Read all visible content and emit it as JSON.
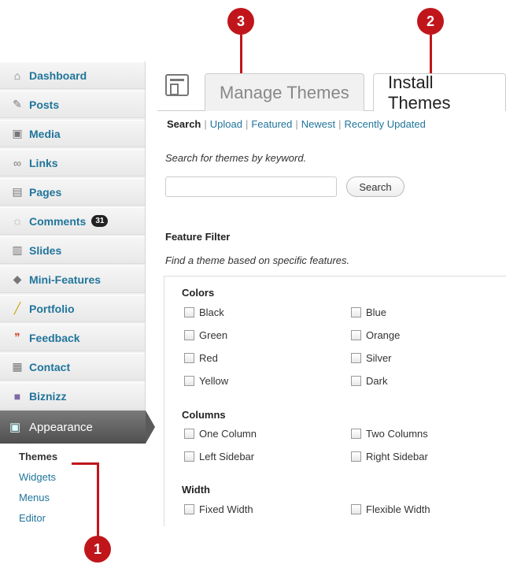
{
  "callouts": [
    "1",
    "2",
    "3"
  ],
  "sidebar": {
    "items": [
      {
        "label": "Dashboard",
        "icon": "home-icon"
      },
      {
        "label": "Posts",
        "icon": "pin-icon"
      },
      {
        "label": "Media",
        "icon": "media-icon"
      },
      {
        "label": "Links",
        "icon": "link-icon"
      },
      {
        "label": "Pages",
        "icon": "pages-icon"
      },
      {
        "label": "Comments",
        "icon": "comment-icon",
        "badge": "31"
      },
      {
        "label": "Slides",
        "icon": "slides-icon"
      },
      {
        "label": "Mini-Features",
        "icon": "gem-icon"
      },
      {
        "label": "Portfolio",
        "icon": "pencil-icon"
      },
      {
        "label": "Feedback",
        "icon": "quote-icon"
      },
      {
        "label": "Contact",
        "icon": "contact-icon"
      },
      {
        "label": "Biznizz",
        "icon": "woo-icon"
      }
    ],
    "appearance": "Appearance",
    "submenu": [
      "Themes",
      "Widgets",
      "Menus",
      "Editor"
    ]
  },
  "tabs": {
    "manage": "Manage Themes",
    "install": "Install Themes"
  },
  "filters": [
    "Search",
    "Upload",
    "Featured",
    "Newest",
    "Recently Updated"
  ],
  "search": {
    "help": "Search for themes by keyword.",
    "button": "Search",
    "value": ""
  },
  "feature_filter": {
    "title": "Feature Filter",
    "help": "Find a theme based on specific features.",
    "colors": {
      "title": "Colors",
      "options": [
        "Black",
        "Blue",
        "Green",
        "Orange",
        "Red",
        "Silver",
        "Yellow",
        "Dark"
      ]
    },
    "columns": {
      "title": "Columns",
      "options": [
        "One Column",
        "Two Columns",
        "Left Sidebar",
        "Right Sidebar"
      ]
    },
    "width": {
      "title": "Width",
      "options": [
        "Fixed Width",
        "Flexible Width"
      ]
    }
  },
  "colors": {
    "accent": "#c0161b",
    "link": "#21759b"
  }
}
